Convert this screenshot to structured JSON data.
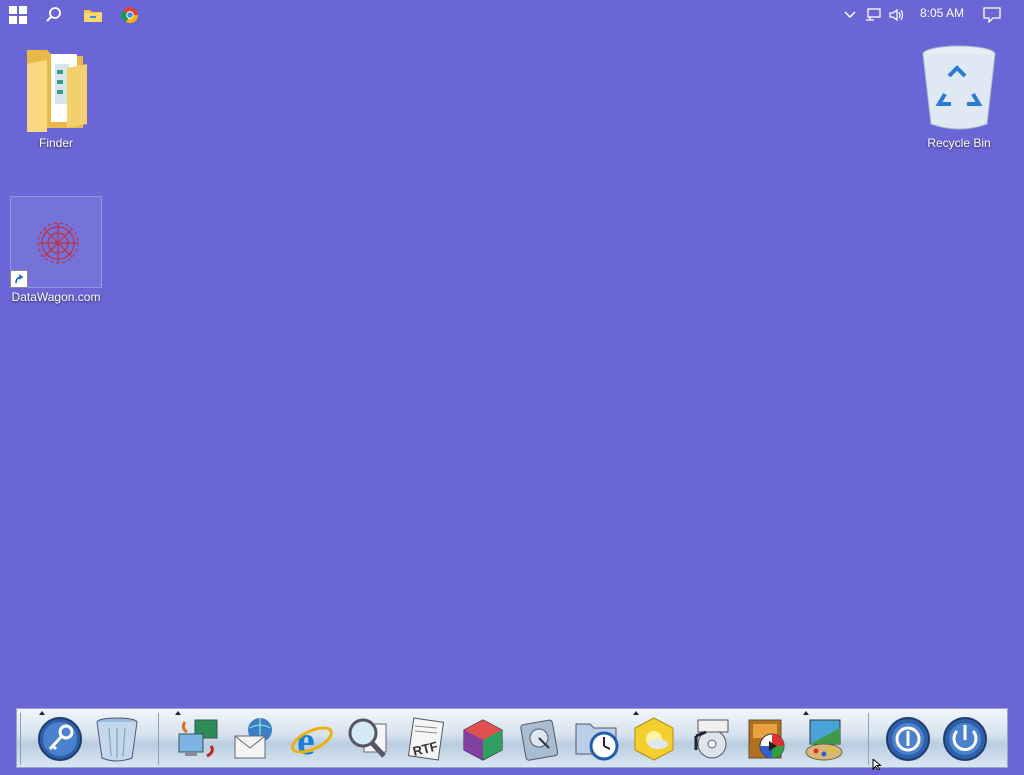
{
  "taskbar": {
    "start_icon": "windows-logo-icon",
    "search_icon": "search-icon",
    "explorer_icon": "file-explorer-icon",
    "chrome_icon": "chrome-icon",
    "tray_chevron_icon": "chevron-up-icon",
    "network_icon": "network-icon",
    "volume_icon": "volume-icon",
    "clock": "8:05 AM",
    "notification_icon": "notification-icon"
  },
  "desktop": {
    "finder_label": "Finder",
    "recycle_bin_label": "Recycle Bin",
    "datawagon_label": "DataWagon.com"
  },
  "dock": {
    "items": [
      "key-icon",
      "trash-can-icon",
      "network-computers-icon",
      "mail-globe-icon",
      "internet-explorer-icon",
      "magnifier-icon",
      "rtf-document-icon",
      "cube-app-icon",
      "hard-drive-icon",
      "folder-clock-icon",
      "weather-icon",
      "music-media-icon",
      "video-player-icon",
      "paint-icon",
      "power-off-icon",
      "power-icon"
    ]
  },
  "colors": {
    "desktop_bg": "#6a66d6",
    "dock_bg": "#d6e2ee"
  }
}
